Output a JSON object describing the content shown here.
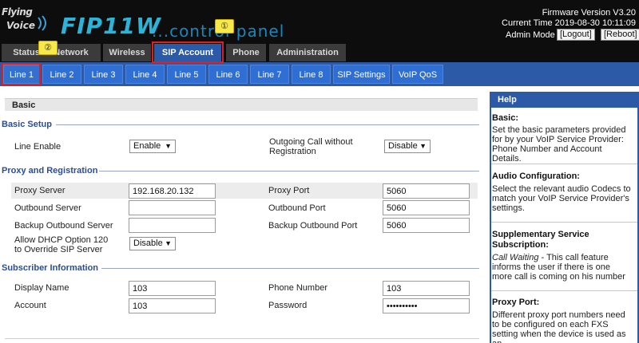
{
  "header": {
    "logo_line1": "Flying",
    "logo_line2": "Voice",
    "model": "FIP11W",
    "panel_text": "...control panel",
    "firmware": "Firmware Version V3.20",
    "current_time": "Current Time 2019-08-30 10:11:09",
    "admin_mode": "Admin Mode",
    "logout_label": "[Logout]",
    "reboot_label": "[Reboot]"
  },
  "main_tabs": [
    "Status",
    "Network",
    "Wireless",
    "SIP Account",
    "Phone",
    "Administration"
  ],
  "sub_tabs": [
    "Line 1",
    "Line 2",
    "Line 3",
    "Line 4",
    "Line 5",
    "Line 6",
    "Line 7",
    "Line 8",
    "SIP Settings",
    "VoIP QoS"
  ],
  "markers": [
    "①",
    "②"
  ],
  "section": {
    "title": "Basic"
  },
  "basic_setup": {
    "title": "Basic Setup",
    "line_enable_label": "Line Enable",
    "line_enable_value": "Enable",
    "outgoing_label": "Outgoing Call without Registration",
    "outgoing_value": "Disable"
  },
  "proxy": {
    "title": "Proxy and Registration",
    "proxy_server_label": "Proxy Server",
    "proxy_server_value": "192.168.20.132",
    "proxy_port_label": "Proxy Port",
    "proxy_port_value": "5060",
    "outbound_server_label": "Outbound Server",
    "outbound_server_value": "",
    "outbound_port_label": "Outbound Port",
    "outbound_port_value": "5060",
    "backup_server_label": "Backup Outbound Server",
    "backup_server_value": "",
    "backup_port_label": "Backup Outbound Port",
    "backup_port_value": "5060",
    "dhcp_label": "Allow DHCP Option 120 to Override SIP Server",
    "dhcp_value": "Disable"
  },
  "subscriber": {
    "title": "Subscriber Information",
    "display_name_label": "Display Name",
    "display_name_value": "103",
    "phone_number_label": "Phone Number",
    "phone_number_value": "103",
    "account_label": "Account",
    "account_value": "103",
    "password_label": "Password",
    "password_value": "••••••••••"
  },
  "help": {
    "title": "Help",
    "basic_title": "Basic:",
    "basic_text": "Set the basic parameters provided for by your VoIP Service Provider: Phone Number and Account Details.",
    "audio_title": "Audio Configuration:",
    "audio_text": "Select the relevant audio Codecs to match your VoIP Service Provider's settings.",
    "supp_title": "Supplementary Service Subscription:",
    "supp_italic": "Call Waiting",
    "supp_text": " - This call feature informs the user if there is one more call is coming on his number",
    "proxy_title": "Proxy Port:",
    "proxy_text": "Different proxy port numbers need to be configured on each FXS setting when the device is used as an"
  },
  "colors": {
    "header_bg": "#0d0d0d",
    "tab_active": "#2b5aa8",
    "subbar": "#2c5aa6",
    "group_title": "#2a4d96",
    "annotation_red": "#e02020",
    "marker_yellow": "#f8e94a"
  }
}
